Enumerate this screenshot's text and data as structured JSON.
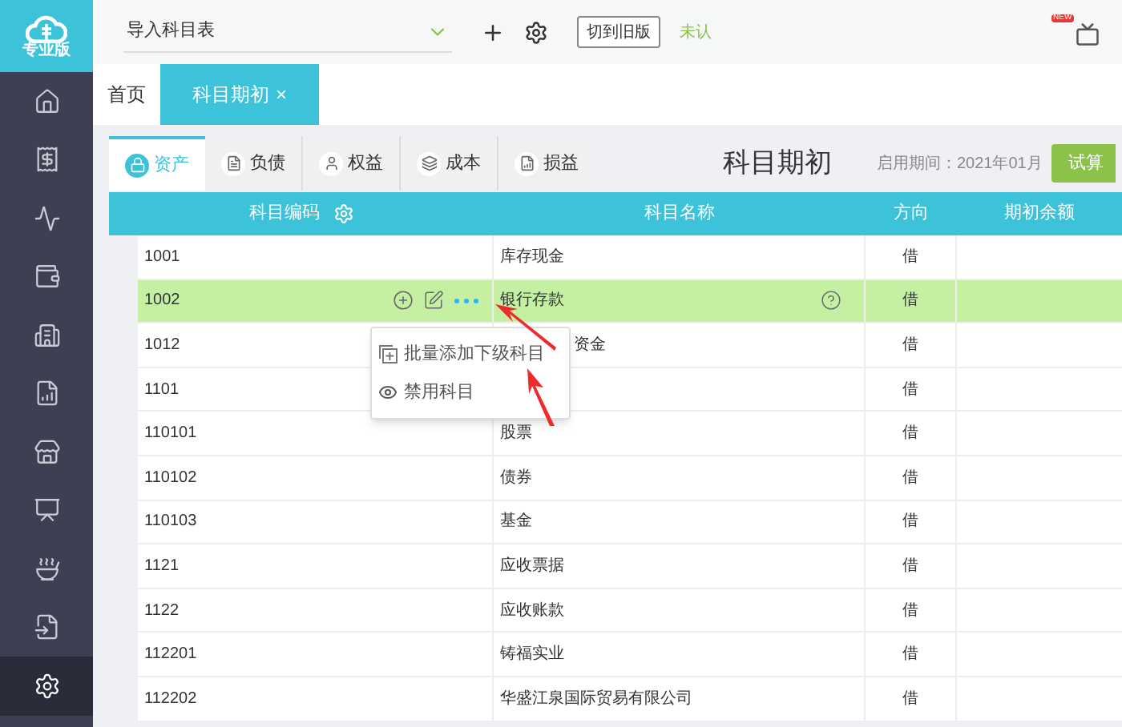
{
  "logo": {
    "label": "专业版"
  },
  "sidebar": {
    "items": [
      {
        "selected": false
      },
      {
        "selected": false
      },
      {
        "selected": false
      },
      {
        "selected": false
      },
      {
        "selected": false
      },
      {
        "selected": false
      },
      {
        "selected": false
      },
      {
        "selected": false
      },
      {
        "selected": false
      },
      {
        "selected": false
      },
      {
        "selected": true
      }
    ]
  },
  "toolbar": {
    "subject_select": {
      "value": "导入科目表"
    },
    "switch_button": "切到旧版",
    "status": "未认",
    "video_badge": "NEW"
  },
  "page_tabs": [
    {
      "label": "首页",
      "selected": false
    },
    {
      "label": "科目期初",
      "selected": true,
      "close": "×"
    }
  ],
  "category_tabs": [
    {
      "label": "资产",
      "selected": true
    },
    {
      "label": "负债",
      "selected": false
    },
    {
      "label": "权益",
      "selected": false
    },
    {
      "label": "成本",
      "selected": false
    },
    {
      "label": "损益",
      "selected": false
    }
  ],
  "title": "科目期初",
  "period": "启用期间：2021年01月",
  "trial_button": "试算",
  "table": {
    "columns": [
      "科目编码",
      "科目名称",
      "方向",
      "期初余额"
    ],
    "rows": [
      {
        "code": "1001",
        "name": "库存现金",
        "direction": "借",
        "selected": false
      },
      {
        "code": "1002",
        "name": "银行存款",
        "direction": "借",
        "selected": true
      },
      {
        "code": "1012",
        "name": "资金",
        "direction": "借",
        "selected": false,
        "partly_hidden": true
      },
      {
        "code": "1101",
        "direction": "借",
        "selected": false
      },
      {
        "code": "110101",
        "name": "股票",
        "direction": "借",
        "selected": false
      },
      {
        "code": "110102",
        "name": "债券",
        "direction": "借",
        "selected": false
      },
      {
        "code": "110103",
        "name": "基金",
        "direction": "借",
        "selected": false
      },
      {
        "code": "1121",
        "name": "应收票据",
        "direction": "借",
        "selected": false
      },
      {
        "code": "1122",
        "name": "应收账款",
        "direction": "借",
        "selected": false
      },
      {
        "code": "112201",
        "name": "铸福实业",
        "direction": "借",
        "selected": false
      },
      {
        "code": "112202",
        "name": "华盛江泉国际贸易有限公司",
        "direction": "借",
        "selected": false
      }
    ]
  },
  "row_menu": {
    "items": [
      {
        "kind": "batch_add",
        "label": "批量添加下级科目"
      },
      {
        "kind": "disable",
        "label": "禁用科目"
      }
    ]
  }
}
